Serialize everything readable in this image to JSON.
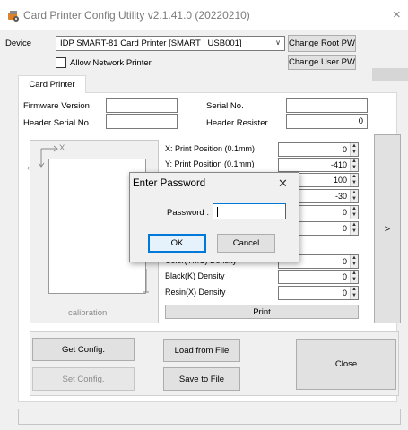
{
  "window": {
    "title": "Card Printer Config Utility v2.1.41.0 (20220210)",
    "close_glyph": "×"
  },
  "device": {
    "label": "Device",
    "selected": "IDP SMART-81 Card Printer  [SMART : USB001]",
    "change_root_pw": "Change Root PW",
    "change_user_pw": "Change User PW",
    "allow_network_label": "Allow Network Printer"
  },
  "tabs": [
    {
      "label": "Card Printer"
    }
  ],
  "info": {
    "firmware_version_label": "Firmware Version",
    "firmware_version_value": "",
    "serial_no_label": "Serial No.",
    "serial_no_value": "",
    "header_serial_label": "Header Serial No.",
    "header_serial_value": "",
    "header_resister_label": "Header Resister",
    "header_resister_value": "0"
  },
  "calibration": {
    "axis_x": "X",
    "label": "calibration"
  },
  "params": [
    {
      "label": "X: Print Position (0.1mm)",
      "value": "0"
    },
    {
      "label": "Y: Print Position (0.1mm)",
      "value": "-410"
    },
    {
      "label": "",
      "value": "100"
    },
    {
      "label": "",
      "value": "-30"
    },
    {
      "label": "",
      "value": "0"
    },
    {
      "label": "",
      "value": "0"
    },
    {
      "label": "Color(YMC) Density",
      "value": "0"
    },
    {
      "label": "Black(K) Density",
      "value": "0"
    },
    {
      "label": "Resin(X) Density",
      "value": "0"
    }
  ],
  "print_button": "Print",
  "next_button": ">",
  "footer": {
    "get_config": "Get Config.",
    "set_config": "Set Config.",
    "load_from_file": "Load from File",
    "save_to_file": "Save to File",
    "close": "Close"
  },
  "dialog": {
    "title": "Enter Password",
    "password_label": "Password :",
    "password_value": "",
    "ok": "OK",
    "cancel": "Cancel",
    "close_glyph": "✕"
  },
  "colors": {
    "accent": "#0078d7",
    "window_bg": "#f0f0f0",
    "button_bg": "#e1e1e1"
  }
}
